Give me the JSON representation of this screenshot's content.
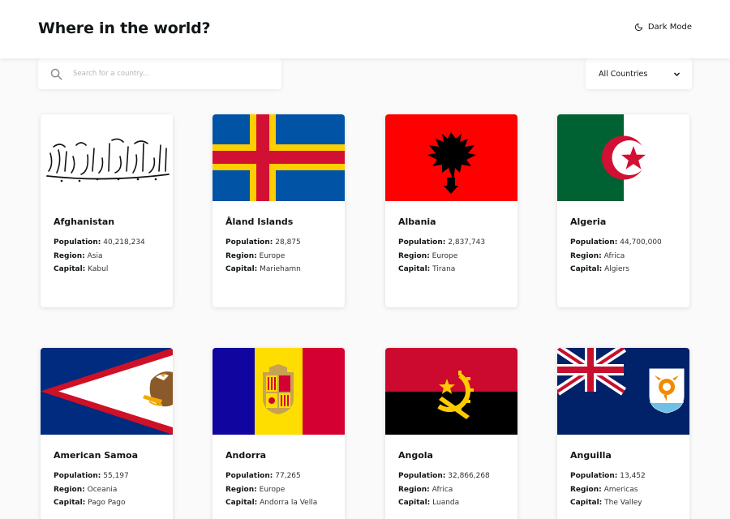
{
  "header": {
    "title": "Where in the world?",
    "dark_mode_label": "Dark Mode"
  },
  "search": {
    "placeholder": "Search for a country...",
    "value": ""
  },
  "filter": {
    "selected": "All Countries"
  },
  "labels": {
    "population": "Population:",
    "region": "Region:",
    "capital": "Capital:"
  },
  "countries": [
    {
      "name": "Afghanistan",
      "population": "40,218,234",
      "region": "Asia",
      "capital": "Kabul"
    },
    {
      "name": "Åland Islands",
      "population": "28,875",
      "region": "Europe",
      "capital": "Mariehamn"
    },
    {
      "name": "Albania",
      "population": "2,837,743",
      "region": "Europe",
      "capital": "Tirana"
    },
    {
      "name": "Algeria",
      "population": "44,700,000",
      "region": "Africa",
      "capital": "Algiers"
    },
    {
      "name": "American Samoa",
      "population": "55,197",
      "region": "Oceania",
      "capital": "Pago Pago"
    },
    {
      "name": "Andorra",
      "population": "77,265",
      "region": "Europe",
      "capital": "Andorra la Vella"
    },
    {
      "name": "Angola",
      "population": "32,866,268",
      "region": "Africa",
      "capital": "Luanda"
    },
    {
      "name": "Anguilla",
      "population": "13,452",
      "region": "Americas",
      "capital": "The Valley"
    }
  ],
  "colors": {
    "background": "#fafafa",
    "element": "#ffffff",
    "text": "#111517"
  }
}
